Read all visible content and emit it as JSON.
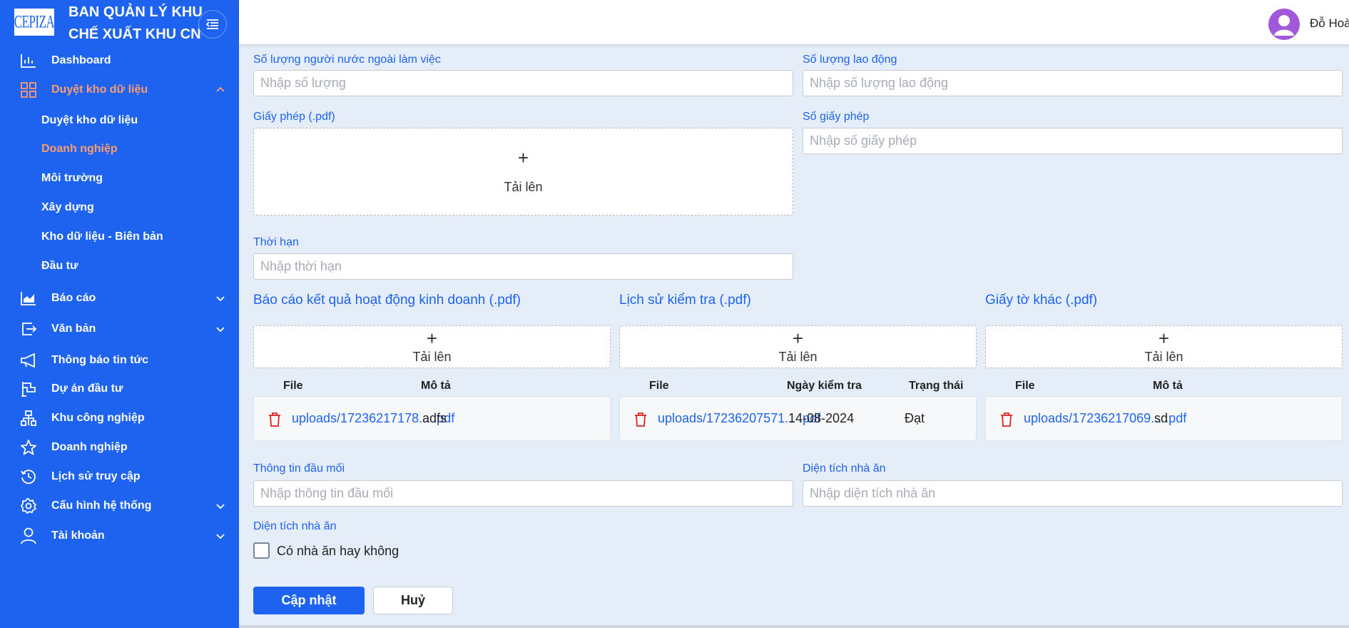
{
  "brand": {
    "logo_text": "CEPIZA",
    "title": "BAN QUẢN LÝ KHU CHẾ XUẤT KHU CN"
  },
  "sidebar": {
    "items": [
      {
        "label": "Dashboard",
        "icon": "bar-chart-icon"
      },
      {
        "label": "Duyệt kho dữ liệu",
        "icon": "grid-icon",
        "expanded": true,
        "active": true
      },
      {
        "label": "Báo cáo",
        "icon": "area-chart-icon"
      },
      {
        "label": "Văn bản",
        "icon": "export-icon"
      },
      {
        "label": "Thông báo tin tức",
        "icon": "megaphone-icon"
      },
      {
        "label": "Dự án đầu tư",
        "icon": "flag-icon"
      },
      {
        "label": "Khu công nghiệp",
        "icon": "cluster-icon"
      },
      {
        "label": "Doanh nghiệp",
        "icon": "star-icon"
      },
      {
        "label": "Lịch sử truy cập",
        "icon": "history-icon"
      },
      {
        "label": "Cấu hình hệ thống",
        "icon": "gear-icon"
      },
      {
        "label": "Tài khoản",
        "icon": "user-icon"
      }
    ],
    "sub_items": [
      {
        "label": "Duyệt kho dữ liệu"
      },
      {
        "label": "Doanh nghiệp",
        "active": true
      },
      {
        "label": "Môi trường"
      },
      {
        "label": "Xây dựng"
      },
      {
        "label": "Kho dữ liệu - Biên bản"
      },
      {
        "label": "Đầu tư"
      }
    ]
  },
  "header": {
    "user_name": "Đỗ Hoà"
  },
  "form": {
    "foreign_workers": {
      "label": "Số lượng người nước ngoài làm việc",
      "placeholder": "Nhập số lượng"
    },
    "workers": {
      "label": "Số lượng lao động",
      "placeholder": "Nhập số lượng lao động"
    },
    "license_file": {
      "label": "Giấy phép (.pdf)",
      "upload_label": "Tải lên"
    },
    "license_no": {
      "label": "Số giấy phép",
      "placeholder": "Nhập số giấy phép"
    },
    "term": {
      "label": "Thời hạn",
      "placeholder": "Nhập thời hạn"
    },
    "business_report": {
      "title": "Báo cáo kết quả hoạt động kinh doanh (.pdf)",
      "upload_label": "Tải lên",
      "columns": [
        "File",
        "Mô tả"
      ],
      "rows": [
        {
          "file": "uploads/17236217178... .pdf",
          "desc": "adfs"
        }
      ]
    },
    "inspection_history": {
      "title": "Lịch sử kiểm tra (.pdf)",
      "upload_label": "Tải lên",
      "columns": [
        "File",
        "Ngày kiểm tra",
        "Trạng thái"
      ],
      "rows": [
        {
          "file": "uploads/17236207571... .pdf",
          "date": "14-08-2024",
          "status": "Đạt"
        }
      ]
    },
    "other_docs": {
      "title": "Giấy tờ khác (.pdf)",
      "upload_label": "Tải lên",
      "columns": [
        "File",
        "Mô tả"
      ],
      "rows": [
        {
          "file": "uploads/17236217069... .pdf",
          "desc": "sd"
        }
      ]
    },
    "contact": {
      "label": "Thông tin đầu mối",
      "placeholder": "Nhập thông tin đầu mối"
    },
    "canteen_area": {
      "label": "Diện tích nhà ăn",
      "placeholder": "Nhập diện tích nhà ăn"
    },
    "canteen_check": {
      "label": "Diện tích nhà ăn",
      "checkbox_label": "Có nhà ăn hay không",
      "checked": false
    }
  },
  "actions": {
    "update": "Cập nhật",
    "cancel": "Huỷ"
  },
  "colors": {
    "primary": "#1e63f0",
    "active_menu": "#ff9c6e",
    "background": "#e4edf8",
    "delete": "#e02424"
  }
}
